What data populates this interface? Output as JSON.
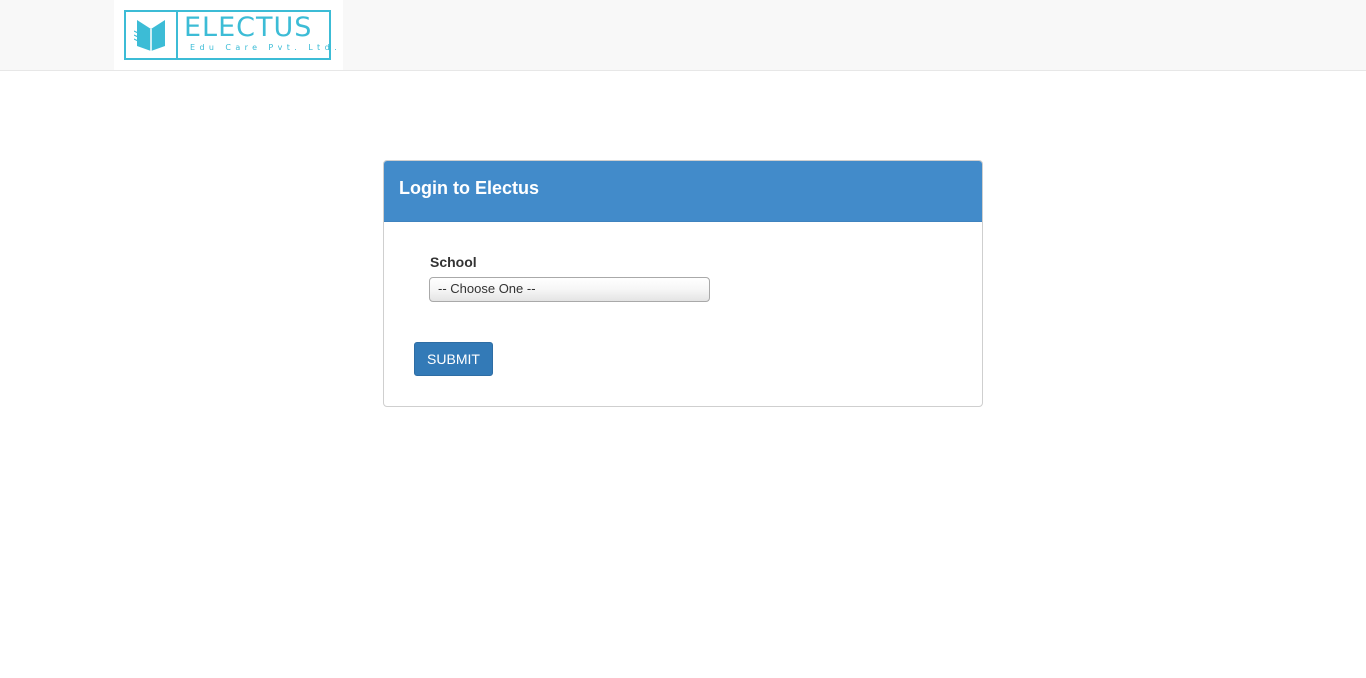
{
  "header": {
    "logo_word": "ELECTUS",
    "logo_subtitle": "Edu Care Pvt. Ltd."
  },
  "login_panel": {
    "title": "Login to Electus",
    "school_label": "School",
    "school_select_value": "-- Choose One --",
    "submit_label": "SUBMIT"
  },
  "colors": {
    "brand_cyan": "#3cbcd6",
    "panel_heading": "#428bca",
    "button_primary": "#337ab7"
  }
}
